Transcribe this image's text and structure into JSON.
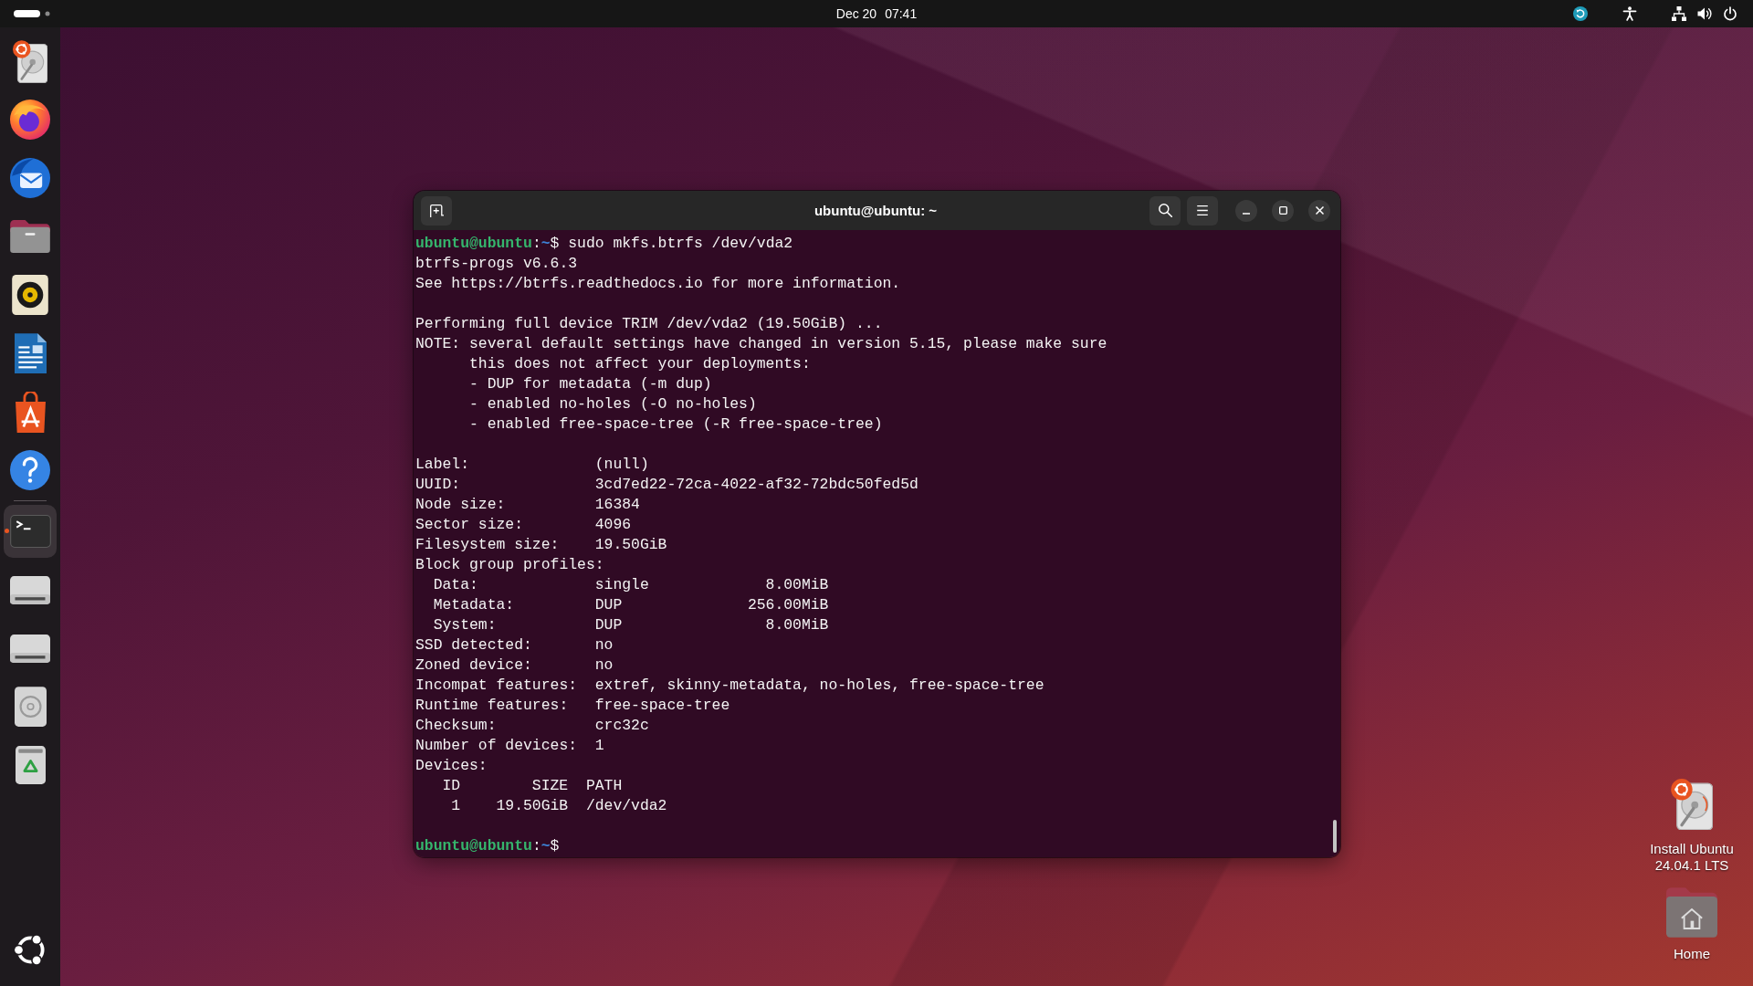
{
  "top_bar": {
    "date": "Dec 20",
    "time": "07:41"
  },
  "dock": {
    "favorites": [
      {
        "kind": "installer",
        "focused": false,
        "running": false
      },
      {
        "kind": "browser",
        "focused": false,
        "running": false
      },
      {
        "kind": "mail",
        "focused": false,
        "running": false
      },
      {
        "kind": "files",
        "focused": false,
        "running": false
      },
      {
        "kind": "music",
        "focused": false,
        "running": false
      },
      {
        "kind": "writer",
        "focused": false,
        "running": false
      },
      {
        "kind": "store",
        "focused": false,
        "running": false
      },
      {
        "kind": "help",
        "focused": false,
        "running": false
      }
    ],
    "others": [
      {
        "kind": "terminal",
        "focused": true,
        "running": true
      },
      {
        "kind": "drive",
        "focused": false,
        "running": false
      },
      {
        "kind": "drive",
        "focused": false,
        "running": false
      },
      {
        "kind": "disc",
        "focused": false,
        "running": false
      },
      {
        "kind": "trash",
        "focused": false,
        "running": false
      }
    ]
  },
  "terminal": {
    "title": "ubuntu@ubuntu: ~",
    "output": [
      {
        "kind": "prompt",
        "user_host": "ubuntu@ubuntu",
        "separator": ":",
        "path": "~",
        "symbol": "$",
        "command": "sudo mkfs.btrfs /dev/vda2"
      },
      {
        "kind": "line",
        "text": "btrfs-progs v6.6.3"
      },
      {
        "kind": "line",
        "text": "See https://btrfs.readthedocs.io for more information."
      },
      {
        "kind": "blank"
      },
      {
        "kind": "line",
        "text": "Performing full device TRIM /dev/vda2 (19.50GiB) ..."
      },
      {
        "kind": "note",
        "label": "NOTE:",
        "lines": [
          "several default settings have changed in version 5.15, please make sure",
          "this does not affect your deployments:"
        ],
        "items": [
          "- DUP for metadata (-m dup)",
          "- enabled no-holes (-O no-holes)",
          "- enabled free-space-tree (-R free-space-tree)"
        ]
      },
      {
        "kind": "blank"
      },
      {
        "kind": "field",
        "key": "Label:",
        "value": "(null)"
      },
      {
        "kind": "field",
        "key": "UUID:",
        "value": "3cd7ed22-72ca-4022-af32-72bdc50fed5d"
      },
      {
        "kind": "field",
        "key": "Node size:",
        "value": "16384"
      },
      {
        "kind": "field",
        "key": "Sector size:",
        "value": "4096"
      },
      {
        "kind": "field",
        "key": "Filesystem size:",
        "value": "19.50GiB"
      },
      {
        "kind": "group",
        "key": "Block group profiles:",
        "children": [
          {
            "key": "Data:",
            "profile": "single",
            "size": "8.00MiB"
          },
          {
            "key": "Metadata:",
            "profile": "DUP",
            "size": "256.00MiB"
          },
          {
            "key": "System:",
            "profile": "DUP",
            "size": "8.00MiB"
          }
        ]
      },
      {
        "kind": "field",
        "key": "SSD detected:",
        "value": "no"
      },
      {
        "kind": "field",
        "key": "Zoned device:",
        "value": "no"
      },
      {
        "kind": "field",
        "key": "Incompat features:",
        "value": "extref, skinny-metadata, no-holes, free-space-tree"
      },
      {
        "kind": "field",
        "key": "Runtime features:",
        "value": "free-space-tree"
      },
      {
        "kind": "field",
        "key": "Checksum:",
        "value": "crc32c"
      },
      {
        "kind": "field",
        "key": "Number of devices:",
        "value": "1"
      },
      {
        "kind": "table",
        "key": "Devices:",
        "columns": [
          "ID",
          "SIZE",
          "PATH"
        ],
        "rows": [
          [
            "1",
            "19.50GiB",
            "/dev/vda2"
          ]
        ]
      },
      {
        "kind": "blank"
      },
      {
        "kind": "prompt",
        "user_host": "ubuntu@ubuntu",
        "separator": ":",
        "path": "~",
        "symbol": "$"
      }
    ]
  },
  "desktop_icons": [
    {
      "kind": "installer",
      "label": "Install Ubuntu 24.04.1 LTS"
    },
    {
      "kind": "home",
      "label": "Home"
    }
  ]
}
